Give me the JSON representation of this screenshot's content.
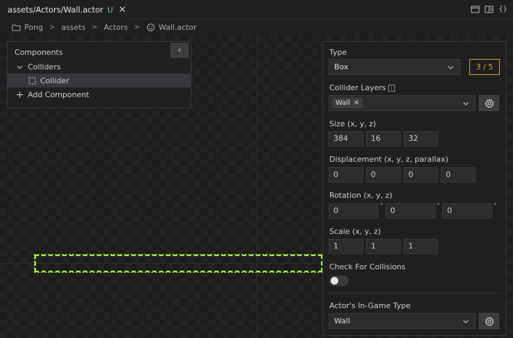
{
  "tab": {
    "title": "assets/Actors/Wall.actor",
    "badge": "U",
    "close_glyph": "✕",
    "icon": "smiley-icon"
  },
  "tab_actions": [
    {
      "icon": "split-editor-icon"
    },
    {
      "icon": "preview-icon"
    },
    {
      "icon": "braces-icon",
      "glyph": "{}"
    }
  ],
  "breadcrumb": {
    "items": [
      "Pong",
      "assets",
      "Actors",
      "Wall.actor"
    ],
    "separator": ">"
  },
  "components": {
    "heading": "Components",
    "collapse_glyph": "‹",
    "items": [
      {
        "label": "Colliders",
        "icon": "chevron-down-icon"
      },
      {
        "label": "Collider",
        "icon": "dashed-box-icon",
        "selected": true
      },
      {
        "label": "Add Component",
        "icon": "plus-icon"
      }
    ]
  },
  "inspector": {
    "type": {
      "label": "Type",
      "value": "Box",
      "counter": "3 / 5"
    },
    "collider_layers": {
      "label": "Collider Layers",
      "info": "i",
      "chips": [
        "Wall"
      ],
      "chip_remove": "✕"
    },
    "size": {
      "label": "Size (x, y, z)",
      "values": [
        "384",
        "16",
        "32"
      ]
    },
    "displacement": {
      "label": "Displacement (x, y, z, parallax)",
      "values": [
        "0",
        "0",
        "0",
        "0"
      ]
    },
    "rotation": {
      "label": "Rotation (x, y, z)",
      "values": [
        "0",
        "0",
        "0"
      ],
      "unit": "°"
    },
    "scale": {
      "label": "Scale (x, y, z)",
      "values": [
        "1",
        "1",
        "1"
      ]
    },
    "check_collisions": {
      "label": "Check For Collisions",
      "enabled": false
    },
    "ingame_type": {
      "label": "Actor's In-Game Type",
      "value": "Wall"
    }
  },
  "colors": {
    "accent_counter": "#d7a630",
    "actor_outline": "#a6f03a",
    "git_untracked": "#73c991"
  }
}
